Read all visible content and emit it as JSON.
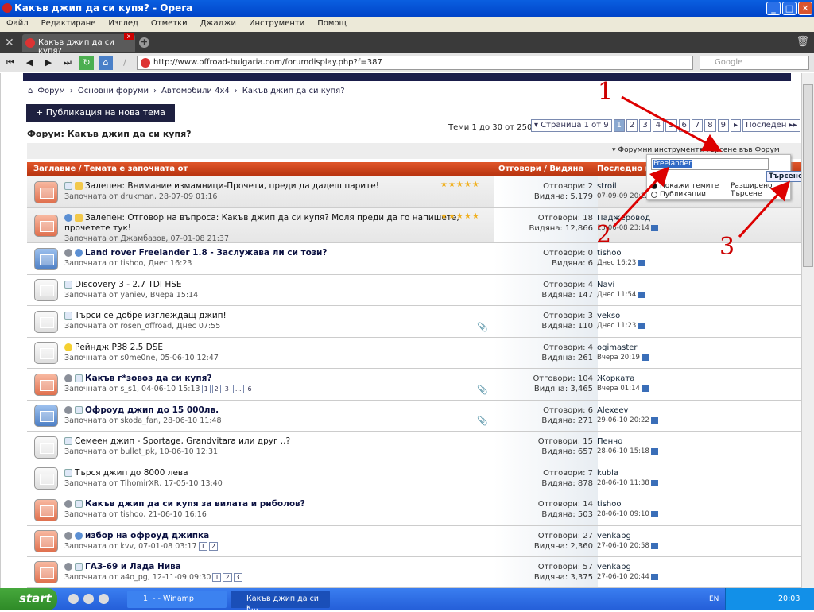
{
  "window": {
    "title": "Какъв джип да си купя? - Opera"
  },
  "menu": [
    "Файл",
    "Редактиране",
    "Изглед",
    "Отметки",
    "Джаджи",
    "Инструменти",
    "Помощ"
  ],
  "tab": {
    "label": "Какъв джип да си купя?"
  },
  "address": {
    "url": "http://www.offroad-bulgaria.com/forumdisplay.php?f=387",
    "search_placeholder": "Google"
  },
  "breadcrumb": [
    "Форум",
    "Основни форуми",
    "Автомобили 4x4",
    "Какъв джип да си купя?"
  ],
  "new_thread": "+ Публикация на нова тема",
  "forum_title": "Форум: Какъв джип да си купя?",
  "thread_count": "Теми 1 до 30 от 250",
  "pager": {
    "label": "▾ Страница 1 от 9",
    "pages": [
      "1",
      "2",
      "3",
      "4",
      "5",
      "6",
      "7",
      "8",
      "9"
    ],
    "current": 1,
    "next": "▸",
    "last": "Последен ▸▸"
  },
  "tools": {
    "forum_tools": "▾ Форумни инструменти",
    "search_forum": "▾ Търсене във Форум"
  },
  "search_popup": {
    "query": "Freelander",
    "button": "Търсене",
    "opt_threads": "Покажи темите",
    "opt_posts": "Публикации",
    "advanced": "Разширено Търсене"
  },
  "columns": {
    "title": "Заглавие / Темата е започната от",
    "stats": "Отговори / Видяна",
    "last": "Последно мнение"
  },
  "threads": [
    {
      "env": "orange",
      "icons": [
        "doc",
        "stk"
      ],
      "title": "Залепен: Внимание измамници-Прочети, преди да дадеш парите!",
      "bold": false,
      "sticky": true,
      "stars": 5,
      "by": "Започната от drukman, 28-07-09 01:16",
      "replies": "Отговори: 2",
      "views": "Видяна: 5,179",
      "last_user": "stroil",
      "last_date": "07-09-09 20:22"
    },
    {
      "env": "orange",
      "icons": [
        "q",
        "stk"
      ],
      "title": "Залепен: Отговор на въпроса: Какъв джип да си купя? Моля преди да го напишете, прочетете тук!",
      "bold": false,
      "sticky": true,
      "stars": 5,
      "by": "Започната от Джамбазов, 07-01-08 21:37",
      "replies": "Отговори: 18",
      "views": "Видяна: 12,866",
      "last_user": "Паджеровод",
      "last_date": "13-06-08 23:14"
    },
    {
      "env": "blue",
      "icons": [
        "arr",
        "q"
      ],
      "title": "Land rover Freelander 1.8 - Заслужава ли си този?",
      "bold": true,
      "by": "Започната от tishoo, Днес 16:23",
      "replies": "Отговори: 0",
      "views": "Видяна: 6",
      "last_user": "tishoo",
      "last_date": "Днес 16:23"
    },
    {
      "env": "gray",
      "icons": [
        "doc"
      ],
      "title": "Discovery 3 - 2.7 TDI HSE",
      "bold": false,
      "by": "Започната от yaniev, Вчера 15:14",
      "replies": "Отговори: 4",
      "views": "Видяна: 147",
      "last_user": "Navi",
      "last_date": "Днес 11:54"
    },
    {
      "env": "gray",
      "icons": [
        "doc"
      ],
      "title": "Търси се добре изглеждащ джип!",
      "bold": false,
      "attach": true,
      "by": "Започната от rosen_offroad, Днес 07:55",
      "replies": "Отговори: 3",
      "views": "Видяна: 110",
      "last_user": "vekso",
      "last_date": "Днес 11:23"
    },
    {
      "env": "gray",
      "icons": [
        "smile"
      ],
      "title": "Рейндж P38 2.5 DSE",
      "bold": false,
      "by": "Започната от s0me0ne, 05-06-10 12:47",
      "replies": "Отговори: 4",
      "views": "Видяна: 261",
      "last_user": "ogimaster",
      "last_date": "Вчера 20:19"
    },
    {
      "env": "orange",
      "icons": [
        "arr",
        "doc"
      ],
      "title": "Какъв г*зовоз да си купя?",
      "bold": true,
      "attach": true,
      "by": "Започната от s_s1, 04-06-10 15:13",
      "pages": [
        "1",
        "2",
        "3",
        "...",
        "6"
      ],
      "replies": "Отговори: 104",
      "views": "Видяна: 3,465",
      "last_user": "Жорката",
      "last_date": "Вчера 01:14"
    },
    {
      "env": "blue",
      "icons": [
        "arr",
        "doc"
      ],
      "title": "Офроуд джип до 15 000лв.",
      "bold": true,
      "attach": true,
      "by": "Започната от skoda_fan, 28-06-10 11:48",
      "replies": "Отговори: 6",
      "views": "Видяна: 271",
      "last_user": "Alexeev",
      "last_date": "29-06-10 20:22"
    },
    {
      "env": "gray",
      "icons": [
        "doc"
      ],
      "title": "Семеен джип - Sportage, Grandvitara или друг ..?",
      "bold": false,
      "by": "Започната от bullet_pk, 10-06-10 12:31",
      "replies": "Отговори: 15",
      "views": "Видяна: 657",
      "last_user": "Пенчо",
      "last_date": "28-06-10 15:18"
    },
    {
      "env": "gray",
      "icons": [
        "doc"
      ],
      "title": "Търся джип до 8000 лева",
      "bold": false,
      "by": "Започната от TihomirXR, 17-05-10 13:40",
      "replies": "Отговори: 7",
      "views": "Видяна: 878",
      "last_user": "kubla",
      "last_date": "28-06-10 11:38"
    },
    {
      "env": "orange",
      "icons": [
        "arr",
        "doc"
      ],
      "title": "Какъв джип да си купя за вилата и риболов?",
      "bold": true,
      "by": "Започната от tishoo, 21-06-10 16:16",
      "replies": "Отговори: 14",
      "views": "Видяна: 503",
      "last_user": "tishoo",
      "last_date": "28-06-10 09:10"
    },
    {
      "env": "orange",
      "icons": [
        "arr",
        "q"
      ],
      "title": "избор на офроуд джипка",
      "bold": true,
      "by": "Започната от kvv, 07-01-08 03:17",
      "pages": [
        "1",
        "2"
      ],
      "replies": "Отговори: 27",
      "views": "Видяна: 2,360",
      "last_user": "venkabg",
      "last_date": "27-06-10 20:58"
    },
    {
      "env": "orange",
      "icons": [
        "arr",
        "doc"
      ],
      "title": "ГАЗ-69 и Лада Нива",
      "bold": true,
      "by": "Започната от a4o_pg, 12-11-09 09:30",
      "pages": [
        "1",
        "2",
        "3"
      ],
      "replies": "Отговори: 57",
      "views": "Видяна: 3,375",
      "last_user": "venkabg",
      "last_date": "27-06-10 20:44"
    }
  ],
  "annotations": [
    "1",
    "2",
    "3"
  ],
  "taskbar": {
    "start": "start",
    "tasks": [
      "1. - - Winamp",
      "Какъв джип да си к..."
    ],
    "lang": "EN",
    "clock": "20:03"
  }
}
